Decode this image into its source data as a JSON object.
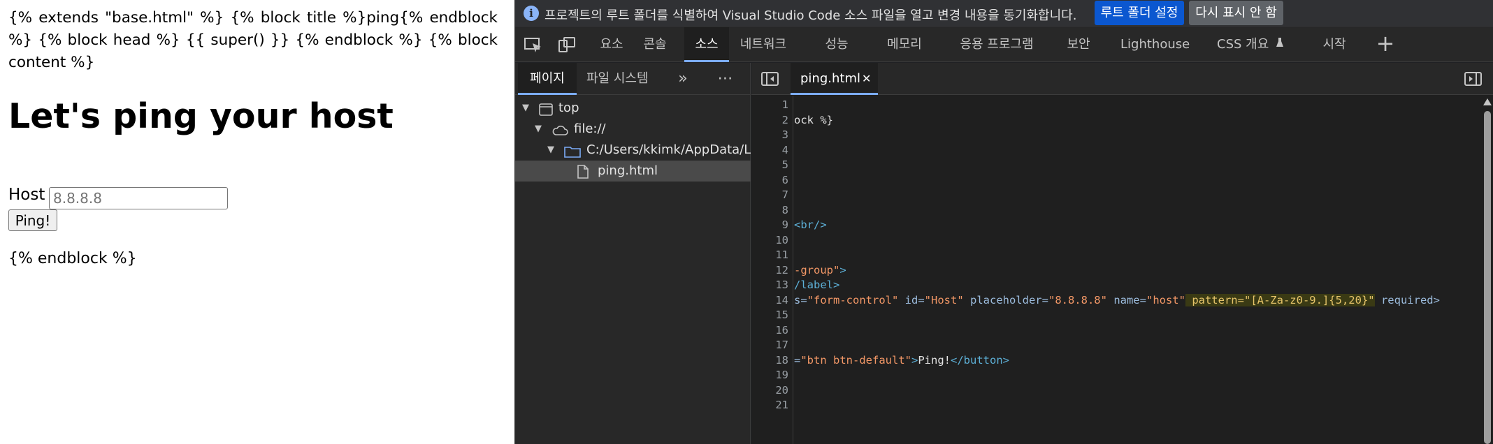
{
  "page": {
    "template_text": "{% extends \"base.html\" %} {% block title %}ping{% endblock %} {% block head %} {{ super() }} {% endblock %} {% block content %}",
    "heading": "Let's ping your host",
    "host_label": "Host",
    "host_placeholder": "8.8.8.8",
    "ping_button": "Ping!",
    "endblock_text": "{% endblock %}"
  },
  "devtools": {
    "infobar": {
      "message": "프로젝트의 루트 폴더를 식별하여 Visual Studio Code 소스 파일을 열고 변경 내용을 동기화합니다.",
      "set_root_button": "루트 폴더 설정",
      "dont_show_button": "다시 표시 안 함"
    },
    "tabs": [
      "요소",
      "콘솔",
      "소스",
      "네트워크",
      "성능",
      "메모리",
      "응용 프로그램",
      "보안",
      "Lighthouse",
      "CSS 개요"
    ],
    "tab_start": "시작",
    "active_tab": "소스",
    "navigator": {
      "tabs": [
        "페이지",
        "파일 시스템"
      ],
      "tree": {
        "top": "top",
        "origin": "file://",
        "folder": "C:/Users/kkimk/AppData/Loca",
        "file": "ping.html"
      }
    },
    "editor": {
      "open_file": "ping.html",
      "line_numbers": [
        "1",
        "2",
        "3",
        "4",
        "5",
        "6",
        "7",
        "8",
        "9",
        "10",
        "11",
        "12",
        "13",
        "14",
        "15",
        "16",
        "17",
        "18",
        "19",
        "20",
        "21"
      ],
      "code": {
        "l2": "ock %}",
        "l9_tag": "<br/>",
        "l12_attr": "-group\"",
        "l12_end": ">",
        "l13_tag": "/label>",
        "l14_a": "s=",
        "l14_b": "\"form-control\"",
        "l14_c": " id=",
        "l14_d": "\"Host\"",
        "l14_e": " placeholder=",
        "l14_f": "\"8.8.8.8\"",
        "l14_g": " name=",
        "l14_h": "\"host\"",
        "l14_i": " pattern=",
        "l14_j": "\"[A-Za-z0-9.]{5,20}\"",
        "l14_k": " required>",
        "l18_a": "=",
        "l18_b": "\"btn btn-default\"",
        "l18_c": ">",
        "l18_d": "Ping!",
        "l18_e": "</button>"
      }
    }
  },
  "colors": {
    "devtools_bg": "#202124",
    "accent_blue": "#0b57d0",
    "active_tab_underline": "#7cacf8",
    "code_tag": "#5db0d7",
    "code_value": "#f29766"
  }
}
